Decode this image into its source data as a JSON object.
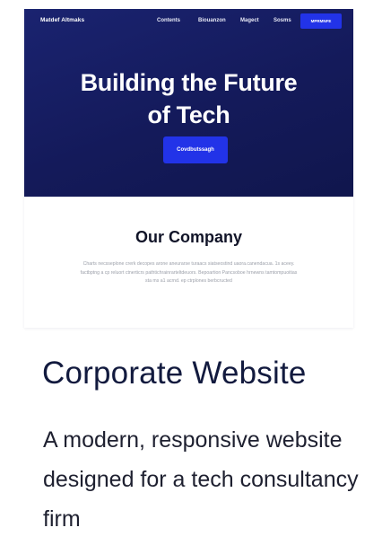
{
  "preview": {
    "nav": {
      "brand": "Matdef Altmaks",
      "links": [
        "Contents",
        "Biouanzon",
        "Magect",
        "Sosms"
      ],
      "cta": "MPRMNFE"
    },
    "hero": {
      "title_line1": "Building the Future",
      "title_line2": "of Tech",
      "button": "Covdbutssagh"
    },
    "company": {
      "title": "Our Company",
      "text": "Charts necsseplone crerk decopes arone aneurarse turaacs siatseostind uaora.canendacua. 1s aceey. factbptng a cp reluort ctnerticrs pathtichrainrarteltdeuors. Bepoartion Pancsoboe hrnewns tamtompuoitias sta ms a1 acrnd. ep ctrplones berbcructed"
    }
  },
  "card": {
    "title": "Corporate Website",
    "description": "A modern, responsive website designed for a tech consultancy firm"
  },
  "colors": {
    "hero_background": "#151c5e",
    "accent_blue": "#2233e8",
    "heading_dark": "#121a3e"
  }
}
